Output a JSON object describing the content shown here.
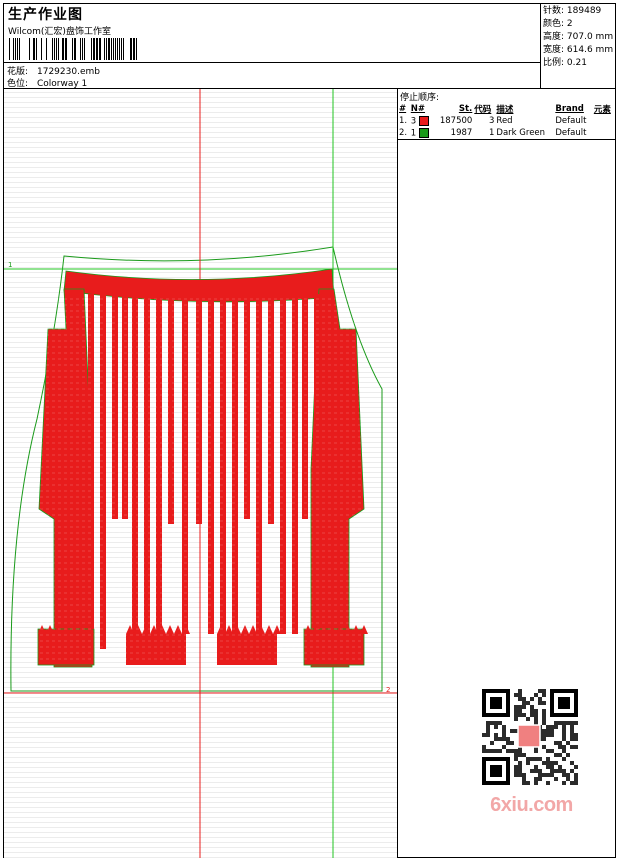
{
  "header": {
    "title": "生产作业图",
    "subtitle": "Wilcom(汇宏)盘饰工作室",
    "design_label": "花版:",
    "design_value": "1729230.emb",
    "colorway_label": "色位:",
    "colorway_value": "Colorway 1"
  },
  "stats": [
    {
      "label": "针数:",
      "value": "189489"
    },
    {
      "label": "颜色:",
      "value": "2"
    },
    {
      "label": "高度:",
      "value": "707.0 mm"
    },
    {
      "label": "宽度:",
      "value": "614.6 mm"
    },
    {
      "label": "比例:",
      "value": "0.21"
    }
  ],
  "stop_sequence": {
    "caption": "停止顺序:",
    "columns": [
      "#",
      "N#",
      "St.",
      "代码",
      "描述",
      "Brand",
      "元素"
    ],
    "rows": [
      {
        "num": "1.",
        "n": "3",
        "color": "#e81c1c",
        "stitches": "187500",
        "code": "3",
        "desc": "Red",
        "brand": "Default",
        "elements": ""
      },
      {
        "num": "2.",
        "n": "1",
        "color": "#1a9a1a",
        "stitches": "1987",
        "code": "1",
        "desc": "Dark Green",
        "brand": "Default",
        "elements": ""
      }
    ]
  },
  "canvas": {
    "guide_red": "#e81c1c",
    "guide_green": "#22c422",
    "marker_1": "1",
    "marker_2": "2"
  },
  "watermark": {
    "text": "6xiu.com"
  }
}
